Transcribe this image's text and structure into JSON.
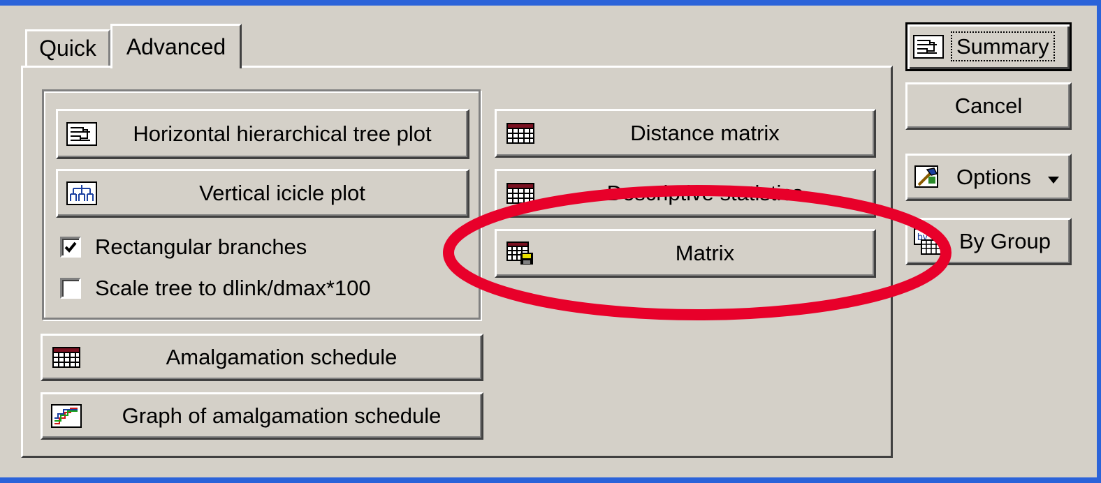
{
  "tabs": [
    {
      "label": "Quick"
    },
    {
      "label": "Advanced"
    }
  ],
  "left_group": {
    "tree_plot_button": "Horizontal hierarchical tree plot",
    "icicle_button": "Vertical icicle plot",
    "checkboxes": [
      {
        "label": "Rectangular branches",
        "checked": true
      },
      {
        "label": "Scale tree to dlink/dmax*100",
        "checked": false
      }
    ]
  },
  "left_buttons": {
    "amalgamation": "Amalgamation schedule",
    "graph": "Graph of amalgamation schedule"
  },
  "middle_buttons": {
    "distance": "Distance matrix",
    "descriptive": "Descriptive statistics",
    "matrix": "Matrix"
  },
  "right_buttons": {
    "summary": "Summary",
    "cancel": "Cancel",
    "options": "Options",
    "by_group": "By Group"
  },
  "colors": {
    "annotation_circle": "#e8002a",
    "background": "#d4d0c8",
    "frame": "#2b63d9"
  }
}
